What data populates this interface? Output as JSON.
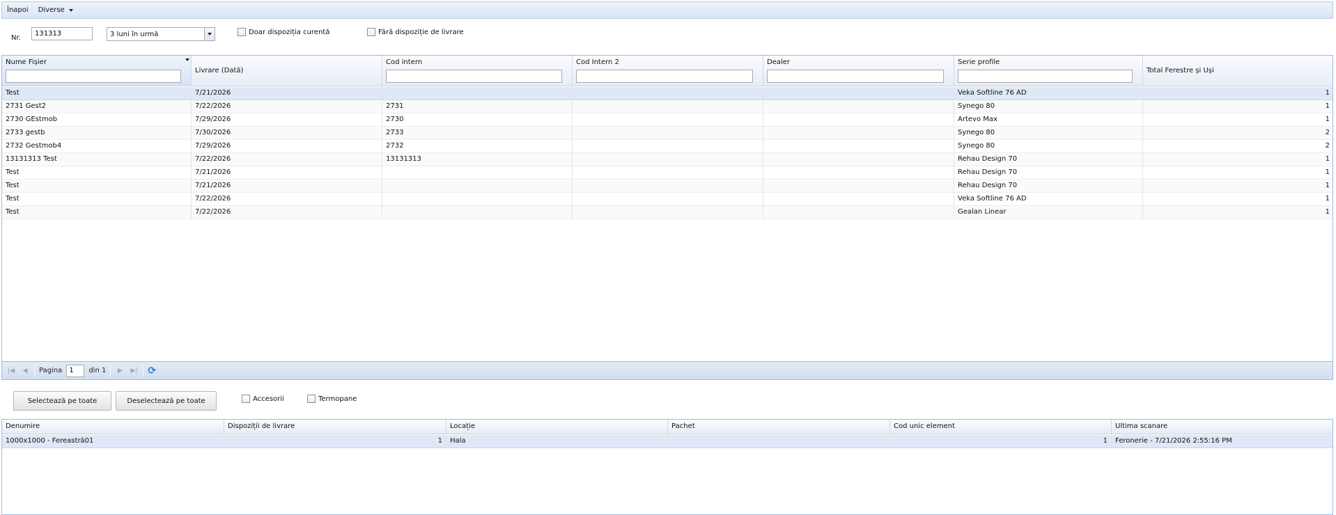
{
  "toolbar": {
    "back": "Înapoi",
    "misc": "Diverse"
  },
  "filters": {
    "nr_label": "Nr.",
    "nr_value": "131313",
    "period": "3 luni în urmă",
    "only_current": "Doar dispoziția curentă",
    "no_disposition": "Fără dispoziție de livrare"
  },
  "grid1": {
    "columns": [
      "Nume Fișier",
      "Livrare (Dată)",
      "Cod intern",
      "Cod Intern 2",
      "Dealer",
      "Serie profile",
      "Total Ferestre și Uși"
    ],
    "rows": [
      [
        "Test",
        "7/21/2026",
        "",
        "",
        "",
        "Veka Softline 76 AD",
        "1"
      ],
      [
        "2731 Gest2",
        "7/22/2026",
        "2731",
        "",
        "",
        "Synego 80",
        "1"
      ],
      [
        "2730 GEstmob",
        "7/29/2026",
        "2730",
        "",
        "",
        "Artevo Max",
        "1"
      ],
      [
        "2733 gestb",
        "7/30/2026",
        "2733",
        "",
        "",
        "Synego 80",
        "2"
      ],
      [
        "2732 Gestmob4",
        "7/29/2026",
        "2732",
        "",
        "",
        "Synego 80",
        "2"
      ],
      [
        "13131313 Test",
        "7/22/2026",
        "13131313",
        "",
        "",
        "Rehau Design 70",
        "1"
      ],
      [
        "Test",
        "7/21/2026",
        "",
        "",
        "",
        "Rehau Design 70",
        "1"
      ],
      [
        "Test",
        "7/21/2026",
        "",
        "",
        "",
        "Rehau Design 70",
        "1"
      ],
      [
        "Test",
        "7/22/2026",
        "",
        "",
        "",
        "Veka Softline 76 AD",
        "1"
      ],
      [
        "Test",
        "7/22/2026",
        "",
        "",
        "",
        "Gealan Linear",
        "1"
      ]
    ]
  },
  "pager": {
    "page_label": "Pagina",
    "page_value": "1",
    "of_label": "din 1"
  },
  "actions": {
    "select_all": "Selectează pe toate",
    "deselect_all": "Deselectează pe toate",
    "accessories": "Accesorii",
    "thermopanes": "Termopane"
  },
  "grid2": {
    "columns": [
      "Denumire",
      "Dispoziții de livrare",
      "Locație",
      "Pachet",
      "Cod unic element",
      "Ultima scanare"
    ],
    "rows": [
      [
        "1000x1000 - Fereastră01",
        "1",
        "Hala",
        "",
        "1",
        "Feronerie - 7/21/2026 2:55:16 PM"
      ]
    ]
  }
}
